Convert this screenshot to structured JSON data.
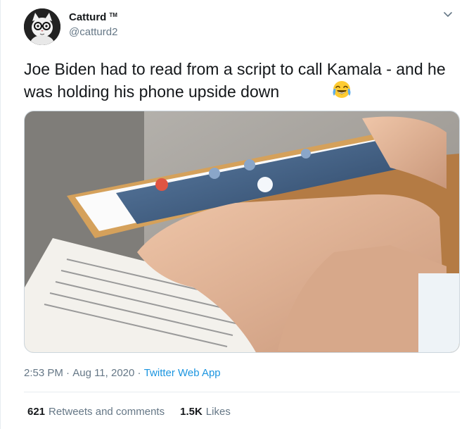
{
  "author": {
    "display_name": "Catturd",
    "tm_mark": "TM",
    "handle": "@catturd2"
  },
  "icons": {
    "avatar": "cat-with-glasses-avatar",
    "more": "chevron-down-icon",
    "emoji": "face-with-tears-of-joy-emoji"
  },
  "tweet": {
    "text": "Joe Biden had to read from a script to call Kamala - and he was holding his phone upside down",
    "media_alt": "Photo of hands holding a smartphone on a call screen above printed script papers"
  },
  "meta": {
    "time": "2:53 PM",
    "separator": " · ",
    "date": "Aug 11, 2020",
    "app": "Twitter Web App"
  },
  "stats": {
    "retweets_count": "621",
    "retweets_label": "Retweets and comments",
    "likes_count": "1.5K",
    "likes_label": "Likes"
  },
  "colors": {
    "link": "#1b95e0",
    "secondary_text": "#657786",
    "primary_text": "#14171a",
    "divider": "#e6ecf0"
  }
}
